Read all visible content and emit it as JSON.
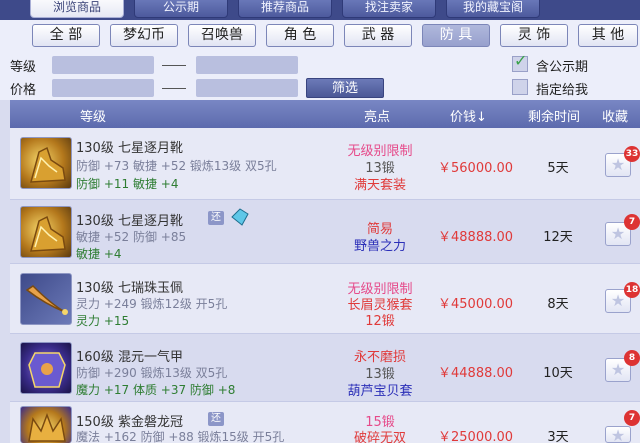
{
  "top_tabs": [
    "浏览商品",
    "公示期",
    "推荐商品",
    "找注卖家",
    "我的藏宝阁"
  ],
  "categories": [
    "全 部",
    "梦幻币",
    "召唤兽",
    "角 色",
    "武 器",
    "防 具",
    "灵 饰",
    "其 他"
  ],
  "active_category": "防 具",
  "filters": {
    "level_label": "等级",
    "price_label": "价格",
    "filter_button": "筛选",
    "include_public": "含公示期",
    "include_public_checked": true,
    "specify_seller": "指定给我",
    "specify_seller_checked": false
  },
  "table": {
    "headers": {
      "level": "等级",
      "highlight": "亮点",
      "price": "价钱",
      "sort_arrow": "↓",
      "remaining": "剩余时间",
      "favorite": "收藏"
    },
    "rows": [
      {
        "name": "130级 七星逐月靴",
        "tag": "",
        "stat1": "防御 +73 敏捷 +52 锻炼13级 双5孔",
        "stat2": "防御 +11 敏捷 +4",
        "hl1": "无级别限制",
        "hl2": "13锻",
        "hl3": "满天套装",
        "price": "￥56000.00",
        "time": "5天",
        "fav_count": "33",
        "icon": "boots-icon"
      },
      {
        "name": "130级 七星逐月靴",
        "tag": "还",
        "stat1": "敏捷 +52 防御 +85",
        "stat2": "敏捷 +4",
        "hl1": "简易",
        "hl2": "野兽之力",
        "hl3": "",
        "price": "￥48888.00",
        "time": "12天",
        "fav_count": "7",
        "icon": "boots-icon"
      },
      {
        "name": "130级 七瑞珠玉佩",
        "tag": "",
        "stat1": "灵力 +249 锻炼12级 开5孔",
        "stat2": "灵力 +15",
        "hl1": "无级别限制",
        "hl2": "长眉灵猴套",
        "hl3": "12锻",
        "price": "￥45000.00",
        "time": "8天",
        "fav_count": "18",
        "icon": "jade-pendant-icon"
      },
      {
        "name": "160级 混元一气甲",
        "tag": "",
        "stat1": "防御 +290 锻炼13级 双5孔",
        "stat2": "魔力 +17 体质 +37 防御 +8",
        "hl1": "永不磨损",
        "hl2": "13锻",
        "hl3": "葫芦宝贝套",
        "price": "￥44888.00",
        "time": "10天",
        "fav_count": "8",
        "icon": "armor-icon"
      },
      {
        "name": "150级 紫金磐龙冠",
        "tag": "还",
        "stat1": "魔法 +162 防御 +88 锻炼15级 开5孔",
        "stat2": "",
        "hl1": "15锻",
        "hl2": "破碎无双",
        "hl3": "",
        "price": "￥25000.00",
        "time": "3天",
        "fav_count": "7",
        "icon": "crown-icon"
      }
    ]
  },
  "colors": {
    "header_blue": "#5c6aad",
    "price_red": "#e03a3a",
    "highlight_pink": "#e64a8a",
    "highlight_blue": "#2b2fb8"
  }
}
